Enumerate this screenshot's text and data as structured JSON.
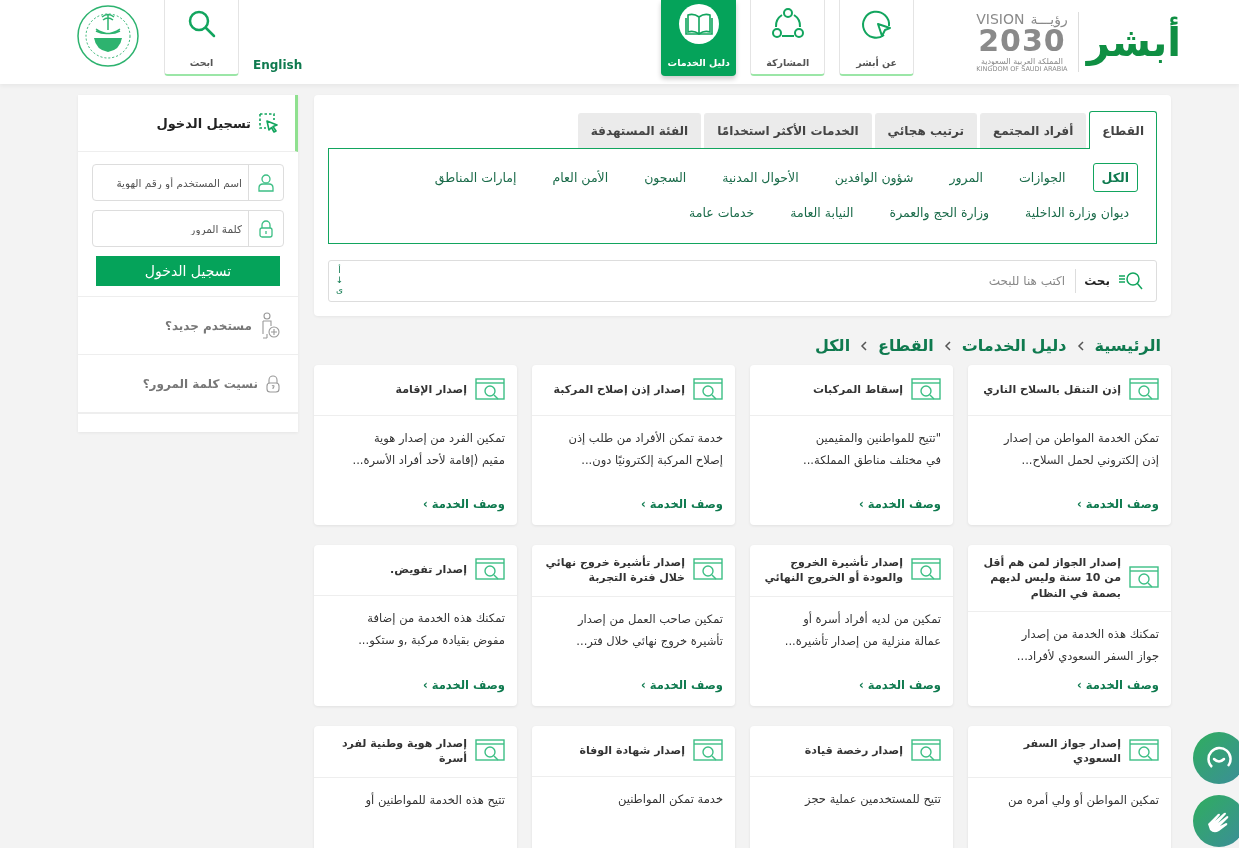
{
  "header": {
    "logo_text": "أبشر",
    "vision_logo": {
      "arabic": "رؤيـــة",
      "english": "VISION",
      "year": "2030",
      "country_ar": "المملكة العربية السعودية",
      "country_en": "KINGDOM OF SAUDI ARABIA"
    },
    "nav": [
      {
        "label": "عن أبشر",
        "kind": "about",
        "selected": false
      },
      {
        "label": "المشاركة",
        "kind": "share",
        "selected": false
      },
      {
        "label": "دليل الخدمات",
        "kind": "guide",
        "selected": true
      }
    ],
    "language": "English",
    "search_button": "ابحث"
  },
  "login": {
    "title": "تسجيل الدخول",
    "username_placeholder": "اسم المستخدم أو رقم الهوية",
    "password_placeholder": "كلمة المرور",
    "submit": "تسجيل الدخول",
    "links": [
      {
        "label": "مستخدم جديد؟",
        "kind": "new-user"
      },
      {
        "label": "نسيت كلمة المرور؟",
        "kind": "forgot"
      }
    ]
  },
  "filters": {
    "tabs": [
      {
        "label": "القطاع",
        "selected": true
      },
      {
        "label": "أفراد المجتمع",
        "selected": false
      },
      {
        "label": "ترتيب هجائي",
        "selected": false
      },
      {
        "label": "الخدمات الأكثر استخدامًا",
        "selected": false
      },
      {
        "label": "الفئة المستهدفة",
        "selected": false
      }
    ],
    "sectors": [
      {
        "label": "الكل",
        "selected": true
      },
      {
        "label": "الجوازات",
        "selected": false
      },
      {
        "label": "المرور",
        "selected": false
      },
      {
        "label": "شؤون الوافدين",
        "selected": false
      },
      {
        "label": "الأحوال المدنية",
        "selected": false
      },
      {
        "label": "السجون",
        "selected": false
      },
      {
        "label": "الأمن العام",
        "selected": false
      },
      {
        "label": "إمارات المناطق",
        "selected": false
      },
      {
        "label": "ديوان وزارة الداخلية",
        "selected": false
      },
      {
        "label": "وزارة الحج والعمرة",
        "selected": false
      },
      {
        "label": "النيابة العامة",
        "selected": false
      },
      {
        "label": "خدمات عامة",
        "selected": false
      }
    ],
    "search": {
      "label": "بحث",
      "placeholder": "اكتب هنا للبحث"
    },
    "sort": "أ↓ى"
  },
  "breadcrumb": [
    "الرئيسية",
    "دليل الخدمات",
    "القطاع",
    "الكل"
  ],
  "services": [
    {
      "title": "إذن التنقل بالسلاح الناري",
      "description": "تمكن الخدمة المواطن من إصدار\nإذن إلكتروني لحمل السلاح...",
      "link": "وصف الخدمة ›"
    },
    {
      "title": "إسقاط المركبات",
      "description": "\"تتيح للمواطنين والمقيمين\nفي مختلف مناطق المملكة...",
      "link": "وصف الخدمة ›"
    },
    {
      "title": "إصدار إذن إصلاح المركبة",
      "description": "خدمة تمكن الأفراد من طلب إذن\nإصلاح المركبة إلكترونيًا دون...",
      "link": "وصف الخدمة ›"
    },
    {
      "title": "إصدار الإقامة",
      "description": "تمكين الفرد من إصدار هوية\nمقيم (إقامة لأحد أفراد الأسرة...",
      "link": "وصف الخدمة ›"
    },
    {
      "title": "إصدار الجواز لمن هم أقل من 10 سنة وليس لديهم بصمة في النظام",
      "description": "تمكنك هذه الخدمة من إصدار\nجواز السفر السعودي لأفراد...",
      "link": "وصف الخدمة ›"
    },
    {
      "title": "إصدار تأشيرة الخروج والعودة أو الخروج النهائي",
      "description": "تمكين من لديه أفراد أسرة أو\nعمالة منزلية من إصدار تأشيرة...",
      "link": "وصف الخدمة ›"
    },
    {
      "title": "إصدار تأشيرة خروج نهائي خلال فترة التجربة",
      "description": "تمكين صاحب العمل من إصدار\nتأشيرة خروج نهائي خلال فتر...",
      "link": "وصف الخدمة ›"
    },
    {
      "title": "إصدار تفويض.",
      "description": "تمكنك هذه الخدمة من إضافة\nمفوض بقيادة مركبة ,و ستكو...",
      "link": "وصف الخدمة ›"
    },
    {
      "title": "إصدار جواز السفر السعودي",
      "description": "تمكين المواطن أو ولي أمره من"
    },
    {
      "title": "إصدار رخصة قيادة",
      "description": "تتيح للمستخدمين عملية حجز"
    },
    {
      "title": "إصدار شهادة الوفاة",
      "description": "خدمة تمكن المواطنين"
    },
    {
      "title": "إصدار هوية وطنية لفرد أسرة",
      "description": "تتيح هذه الخدمة للمواطنين أو"
    }
  ],
  "floating": [
    {
      "kind": "chat"
    },
    {
      "kind": "sign-language"
    }
  ]
}
